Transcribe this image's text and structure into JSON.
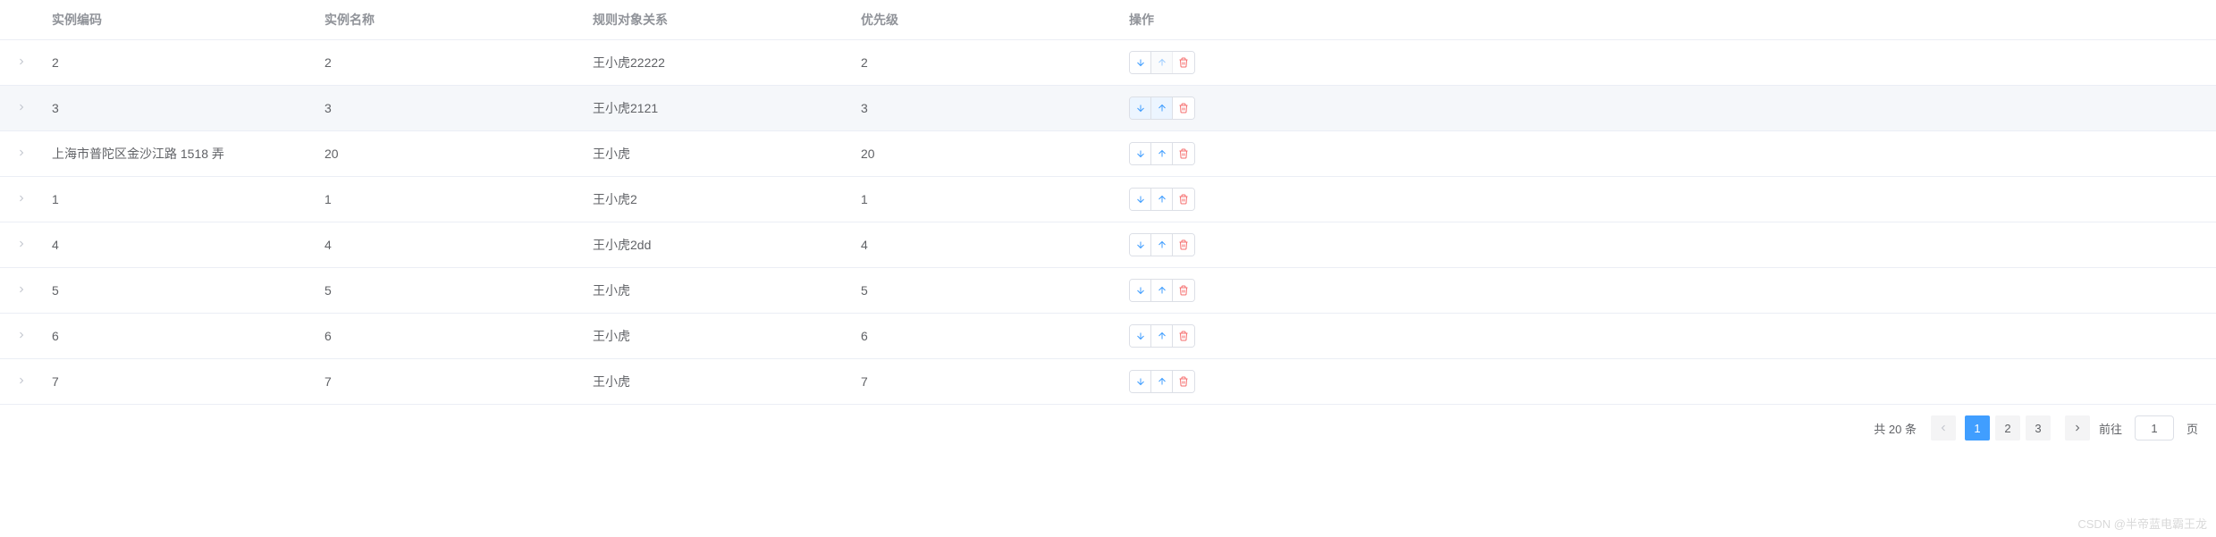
{
  "table": {
    "headers": {
      "code": "实例编码",
      "name": "实例名称",
      "relation": "规则对象关系",
      "priority": "优先级",
      "action": "操作"
    },
    "rows": [
      {
        "code": "2",
        "name": "2",
        "relation": "王小虎22222",
        "priority": "2",
        "up_disabled": true,
        "hover": false
      },
      {
        "code": "3",
        "name": "3",
        "relation": "王小虎2121",
        "priority": "3",
        "up_disabled": false,
        "hover": true,
        "highlight_up": true,
        "highlight_down": true
      },
      {
        "code": "上海市普陀区金沙江路 1518 弄",
        "name": "20",
        "relation": "王小虎",
        "priority": "20",
        "up_disabled": false,
        "hover": false
      },
      {
        "code": "1",
        "name": "1",
        "relation": "王小虎2",
        "priority": "1",
        "up_disabled": false,
        "hover": false
      },
      {
        "code": "4",
        "name": "4",
        "relation": "王小虎2dd",
        "priority": "4",
        "up_disabled": false,
        "hover": false
      },
      {
        "code": "5",
        "name": "5",
        "relation": "王小虎",
        "priority": "5",
        "up_disabled": false,
        "hover": false
      },
      {
        "code": "6",
        "name": "6",
        "relation": "王小虎",
        "priority": "6",
        "up_disabled": false,
        "hover": false
      },
      {
        "code": "7",
        "name": "7",
        "relation": "王小虎",
        "priority": "7",
        "up_disabled": false,
        "hover": false
      }
    ]
  },
  "pagination": {
    "total_label_prefix": "共",
    "total_label_suffix": "条",
    "total_count": "20",
    "pages": [
      "1",
      "2",
      "3"
    ],
    "active_page": "1",
    "goto_label": "前往",
    "page_suffix": "页",
    "goto_value": "1"
  },
  "watermark": "CSDN @半帝蓝电霸王龙"
}
